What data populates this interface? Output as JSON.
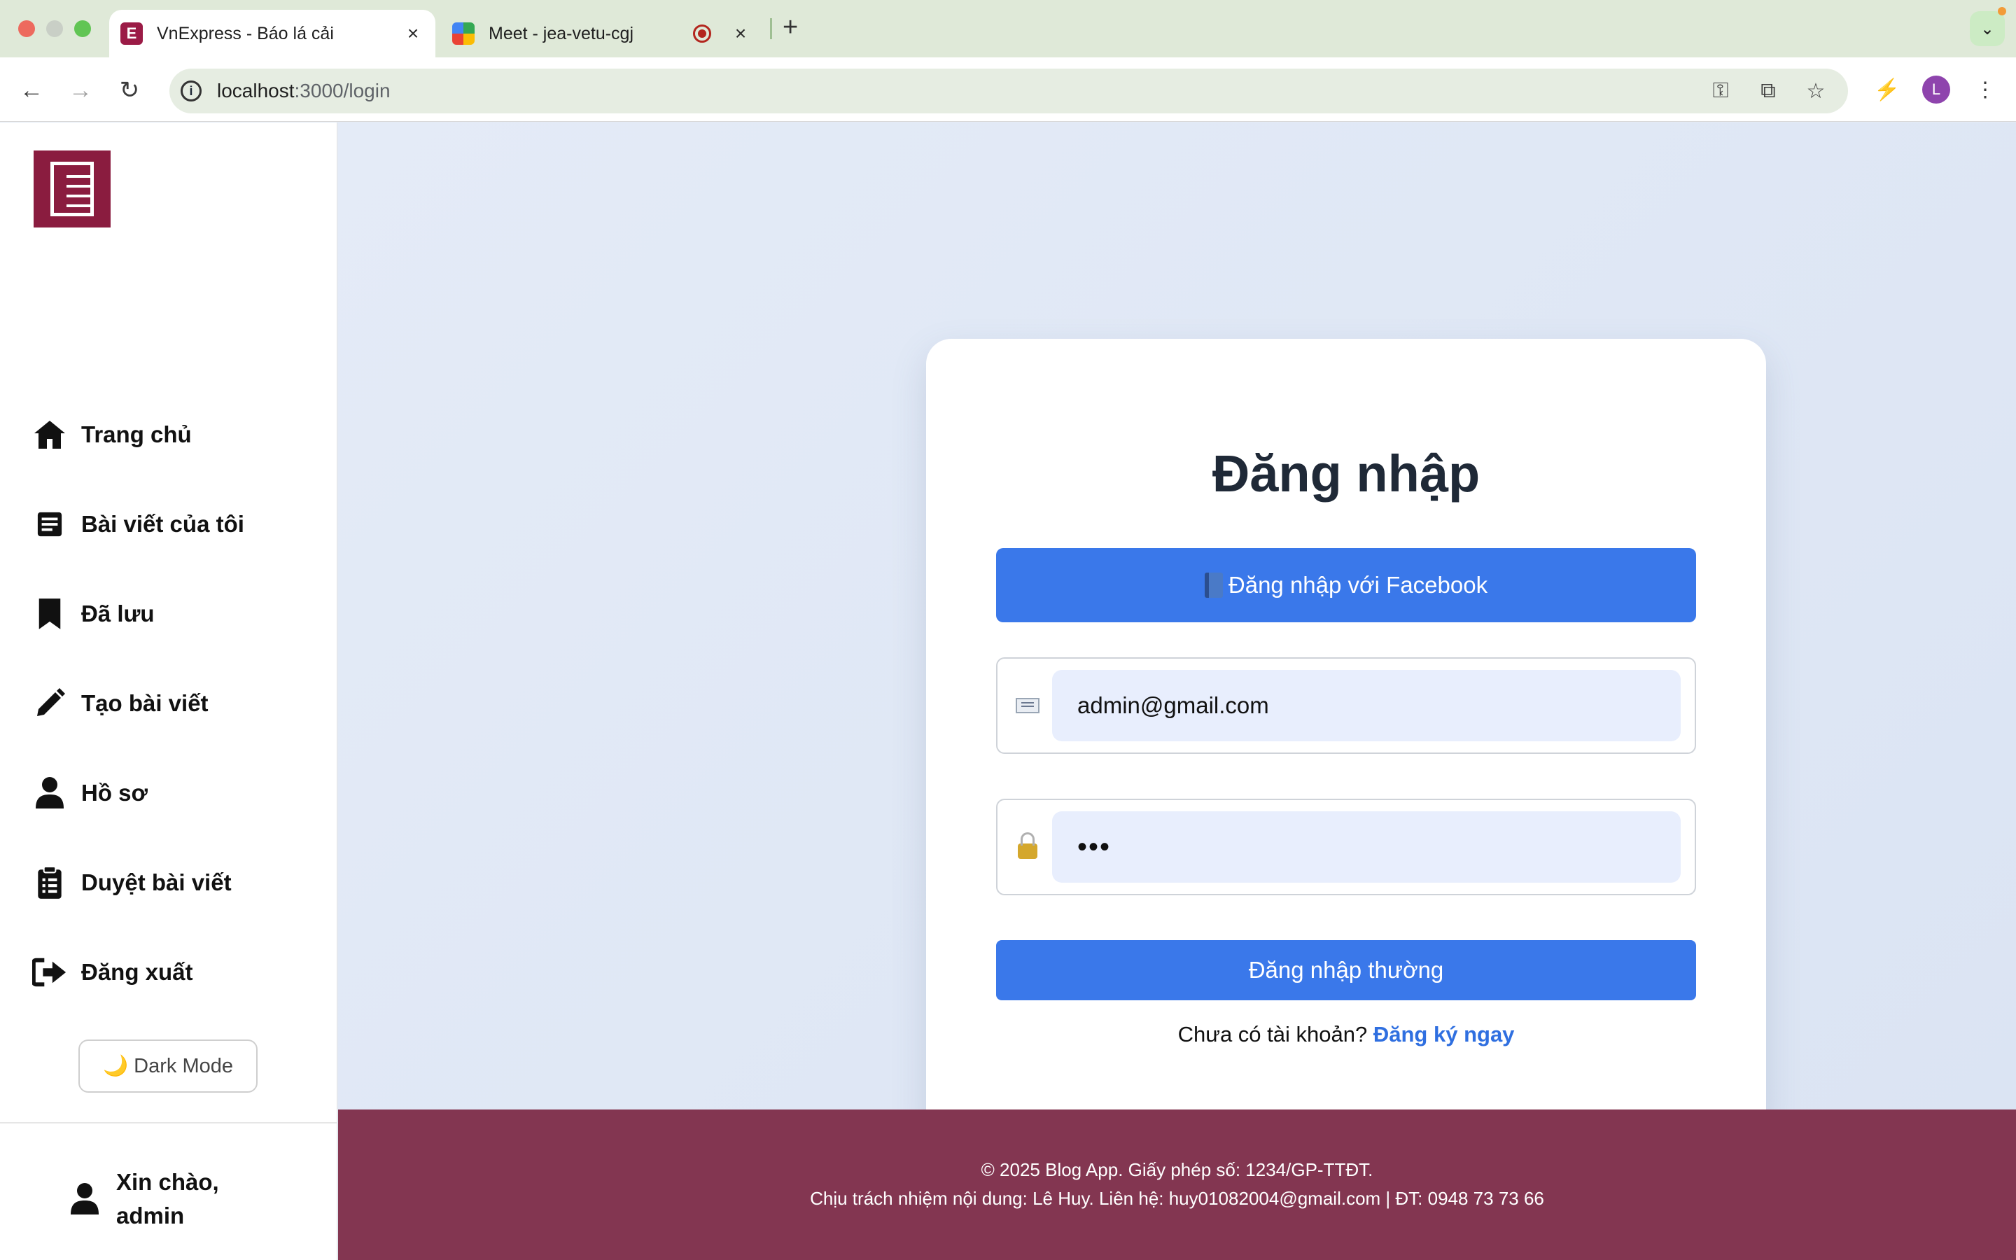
{
  "browser": {
    "tabs": [
      {
        "title": "VnExpress - Báo lá cải",
        "active": true
      },
      {
        "title": "Meet - jea-vetu-cgj",
        "active": false
      }
    ],
    "url_host": "localhost",
    "url_rest": ":3000/login",
    "profile_initial": "L"
  },
  "sidebar": {
    "items": [
      {
        "label": "Trang chủ",
        "icon": "home-icon"
      },
      {
        "label": "Bài viết của tôi",
        "icon": "article-icon"
      },
      {
        "label": "Đã lưu",
        "icon": "bookmark-icon"
      },
      {
        "label": "Tạo bài viết",
        "icon": "pencil-icon"
      },
      {
        "label": "Hồ sơ",
        "icon": "user-icon"
      },
      {
        "label": "Duyệt bài viết",
        "icon": "clipboard-icon"
      },
      {
        "label": "Đăng xuất",
        "icon": "logout-icon"
      }
    ],
    "dark_mode_label": "🌙 Dark Mode",
    "greeting": "Xin chào, admin"
  },
  "login": {
    "title": "Đăng nhập",
    "facebook_label": "Đăng nhập với Facebook",
    "email_value": "admin@gmail.com",
    "password_value": "•••",
    "submit_label": "Đăng nhập thường",
    "signup_prompt": "Chưa có tài khoản?",
    "signup_link": "Đăng ký ngay"
  },
  "footer": {
    "line1": "© 2025 Blog App. Giấy phép số: 1234/GP-TTĐT.",
    "line2": "Chịu trách nhiệm nội dung: Lê Huy. Liên hệ: huy01082004@gmail.com | ĐT: 0948 73 73 66"
  },
  "colors": {
    "primary_button": "#3a78ea",
    "footer_bg": "#833651",
    "logo_bg": "#8a1c3f",
    "link": "#2f6fe0"
  }
}
